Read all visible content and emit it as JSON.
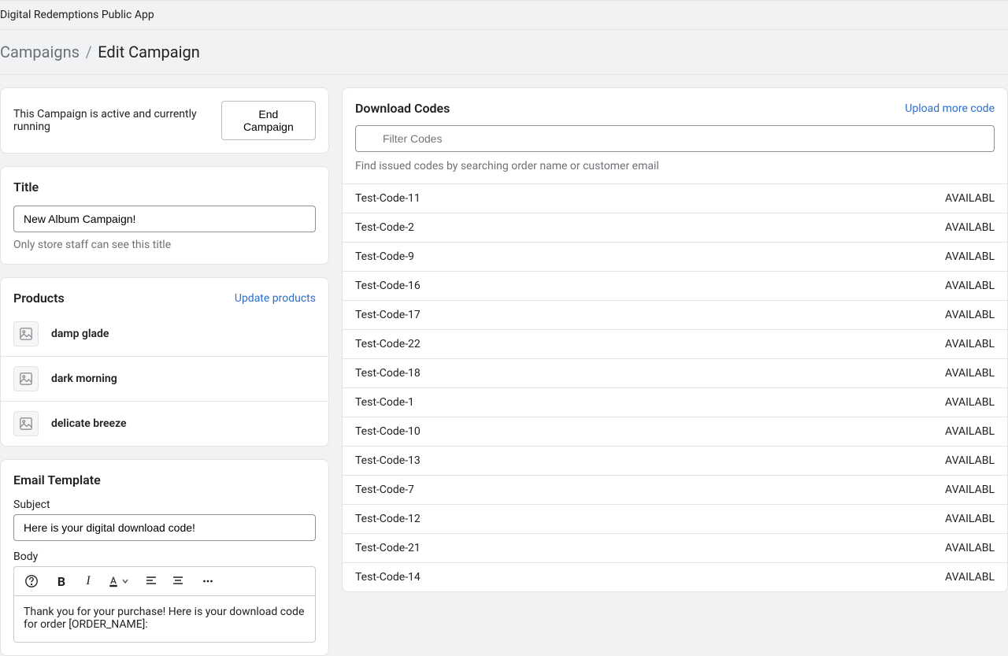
{
  "header": {
    "app_name": "Digital Redemptions Public App"
  },
  "breadcrumb": {
    "parent": "Campaigns",
    "sep": "/",
    "current": "Edit Campaign"
  },
  "status": {
    "text": "This Campaign is active and currently running",
    "end_button": "End Campaign"
  },
  "title_section": {
    "heading": "Title",
    "value": "New Album Campaign!",
    "helper": "Only store staff can see this title"
  },
  "products_section": {
    "heading": "Products",
    "update_link": "Update products",
    "items": [
      {
        "name": "damp glade"
      },
      {
        "name": "dark morning"
      },
      {
        "name": "delicate breeze"
      }
    ]
  },
  "email_section": {
    "heading": "Email Template",
    "subject_label": "Subject",
    "subject_value": "Here is your digital download code!",
    "body_label": "Body",
    "body_text": "Thank you for your purchase! Here is your download code for order [ORDER_NAME]:"
  },
  "codes_section": {
    "heading": "Download Codes",
    "upload_link": "Upload more code",
    "filter_placeholder": "Filter Codes",
    "search_helper": "Find issued codes by searching order name or customer email",
    "codes": [
      {
        "code": "Test-Code-11",
        "status": "AVAILABL"
      },
      {
        "code": "Test-Code-2",
        "status": "AVAILABL"
      },
      {
        "code": "Test-Code-9",
        "status": "AVAILABL"
      },
      {
        "code": "Test-Code-16",
        "status": "AVAILABL"
      },
      {
        "code": "Test-Code-17",
        "status": "AVAILABL"
      },
      {
        "code": "Test-Code-22",
        "status": "AVAILABL"
      },
      {
        "code": "Test-Code-18",
        "status": "AVAILABL"
      },
      {
        "code": "Test-Code-1",
        "status": "AVAILABL"
      },
      {
        "code": "Test-Code-10",
        "status": "AVAILABL"
      },
      {
        "code": "Test-Code-13",
        "status": "AVAILABL"
      },
      {
        "code": "Test-Code-7",
        "status": "AVAILABL"
      },
      {
        "code": "Test-Code-12",
        "status": "AVAILABL"
      },
      {
        "code": "Test-Code-21",
        "status": "AVAILABL"
      },
      {
        "code": "Test-Code-14",
        "status": "AVAILABL"
      }
    ]
  }
}
